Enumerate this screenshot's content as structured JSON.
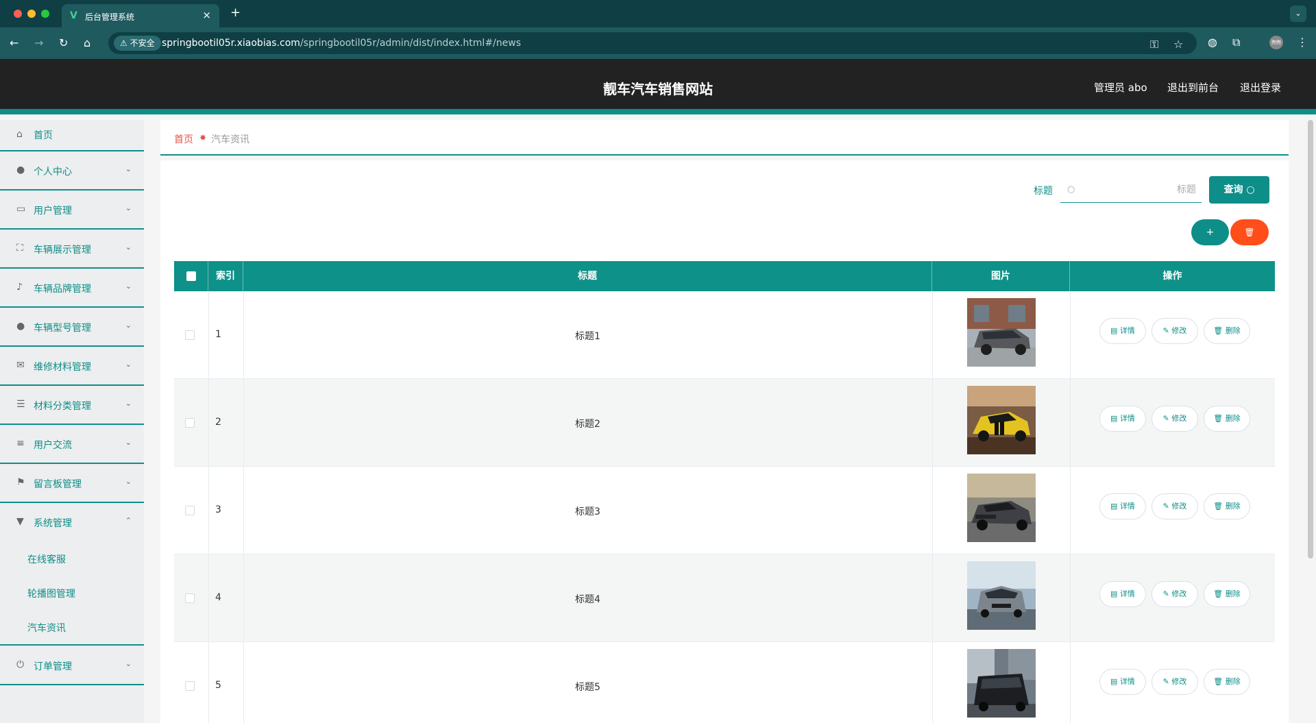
{
  "browser": {
    "tab_title": "后台管理系统",
    "new_tab": "+",
    "insecure_label": "不安全",
    "url_host": "springbootil05r.xiaobias.com",
    "url_path": "/springbootil05r/admin/dist/index.html#/news",
    "profile_label": "煦煦"
  },
  "header": {
    "site_title": "靓车汽车销售网站",
    "user_label": "管理员 abo",
    "front_link": "退出到前台",
    "logout_link": "退出登录"
  },
  "sidebar": {
    "items": [
      {
        "label": "首页",
        "icon": "home-icon",
        "expandable": false
      },
      {
        "label": "个人中心",
        "icon": "user-icon",
        "expandable": true
      },
      {
        "label": "用户管理",
        "icon": "chat-icon",
        "expandable": true
      },
      {
        "label": "车辆展示管理",
        "icon": "fullscreen-icon",
        "expandable": true
      },
      {
        "label": "车辆品牌管理",
        "icon": "bell-icon",
        "expandable": true
      },
      {
        "label": "车辆型号管理",
        "icon": "bulb-icon",
        "expandable": true
      },
      {
        "label": "维修材料管理",
        "icon": "mail-icon",
        "expandable": true
      },
      {
        "label": "材料分类管理",
        "icon": "list-icon",
        "expandable": true
      },
      {
        "label": "用户交流",
        "icon": "sliders-icon",
        "expandable": true
      },
      {
        "label": "留言板管理",
        "icon": "flag-icon",
        "expandable": true
      },
      {
        "label": "系统管理",
        "icon": "brush-icon",
        "expandable": true,
        "expanded": true
      },
      {
        "label": "订单管理",
        "icon": "power-icon",
        "expandable": true
      }
    ],
    "sub_items": [
      {
        "label": "在线客服"
      },
      {
        "label": "轮播图管理"
      },
      {
        "label": "汽车资讯"
      }
    ]
  },
  "breadcrumb": {
    "home": "首页",
    "current": "汽车资讯"
  },
  "search": {
    "label": "标题",
    "placeholder": "标题",
    "value": "",
    "button": "查询"
  },
  "actions": {
    "add": "+",
    "delete": "🗑"
  },
  "table": {
    "columns": [
      "",
      "索引",
      "标题",
      "图片",
      "操作"
    ],
    "rows": [
      {
        "index": "1",
        "title": "标题1",
        "image": "grey minivan photo"
      },
      {
        "index": "2",
        "title": "标题2",
        "image": "yellow sports car photo"
      },
      {
        "index": "3",
        "title": "标题3",
        "image": "dark grey muscle car photo"
      },
      {
        "index": "4",
        "title": "标题4",
        "image": "grey crossover photo"
      },
      {
        "index": "5",
        "title": "标题5",
        "image": "black suv photo"
      }
    ],
    "row_actions": {
      "detail": "详情",
      "edit": "修改",
      "delete": "删除"
    }
  },
  "colors": {
    "accent": "#0e8e88",
    "danger": "#ff4e1a",
    "header_bg": "#222222",
    "breadcrumb_home": "#e0534d"
  }
}
